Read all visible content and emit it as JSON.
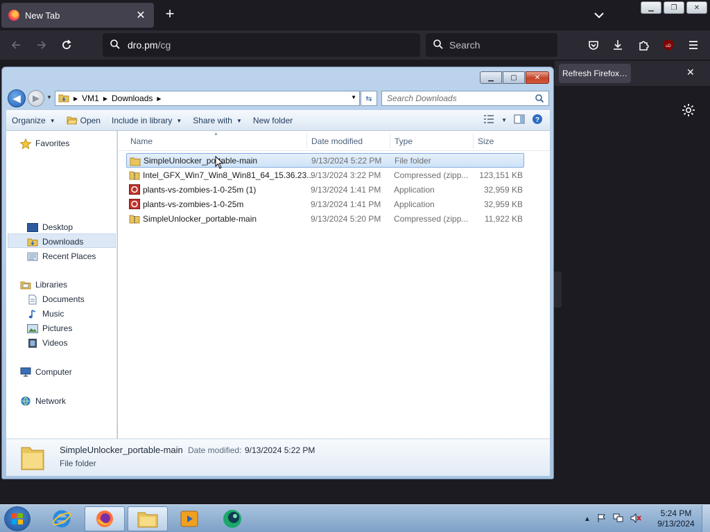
{
  "firefox": {
    "tab_title": "New Tab",
    "new_tab_label": "+",
    "url_host": "dro.pm",
    "url_path": "/cg",
    "search_placeholder": "Search",
    "notification_button": "Refresh Firefox…",
    "extension_badge": "uD"
  },
  "explorer": {
    "breadcrumb": [
      "VM1",
      "Downloads"
    ],
    "search_placeholder": "Search Downloads",
    "commands": {
      "organize": "Organize",
      "open": "Open",
      "include_in_library": "Include in library",
      "share_with": "Share with",
      "new_folder": "New folder"
    },
    "nav": {
      "favorites": "Favorites",
      "desktop": "Desktop",
      "downloads": "Downloads",
      "recent_places": "Recent Places",
      "libraries": "Libraries",
      "documents": "Documents",
      "music": "Music",
      "pictures": "Pictures",
      "videos": "Videos",
      "computer": "Computer",
      "network": "Network"
    },
    "columns": {
      "name": "Name",
      "date_modified": "Date modified",
      "type": "Type",
      "size": "Size"
    },
    "files": [
      {
        "name": "SimpleUnlocker_portable-main",
        "date": "9/13/2024 5:22 PM",
        "type": "File folder",
        "size": "",
        "icon": "folder-icon",
        "selected": true
      },
      {
        "name": "Intel_GFX_Win7_Win8_Win81_64_15.36.23...",
        "date": "9/13/2024 3:22 PM",
        "type": "Compressed (zipp...",
        "size": "123,151 KB",
        "icon": "zip-icon",
        "selected": false
      },
      {
        "name": "plants-vs-zombies-1-0-25m (1)",
        "date": "9/13/2024 1:41 PM",
        "type": "Application",
        "size": "32,959 KB",
        "icon": "app-icon",
        "selected": false
      },
      {
        "name": "plants-vs-zombies-1-0-25m",
        "date": "9/13/2024 1:41 PM",
        "type": "Application",
        "size": "32,959 KB",
        "icon": "app-icon",
        "selected": false
      },
      {
        "name": "SimpleUnlocker_portable-main",
        "date": "9/13/2024 5:20 PM",
        "type": "Compressed (zipp...",
        "size": "11,922 KB",
        "icon": "zip-icon",
        "selected": false
      }
    ],
    "details": {
      "name": "SimpleUnlocker_portable-main",
      "date_label": "Date modified:",
      "date_value": "9/13/2024 5:22 PM",
      "type": "File folder"
    }
  },
  "taskbar": {
    "clock_time": "5:24 PM",
    "clock_date": "9/13/2024"
  },
  "colors": {
    "firefox_bg": "#1c1b22",
    "firefox_toolbar": "#2b2a33",
    "selection": "#cfe3f8",
    "taskbar": "#8fb0d3"
  }
}
